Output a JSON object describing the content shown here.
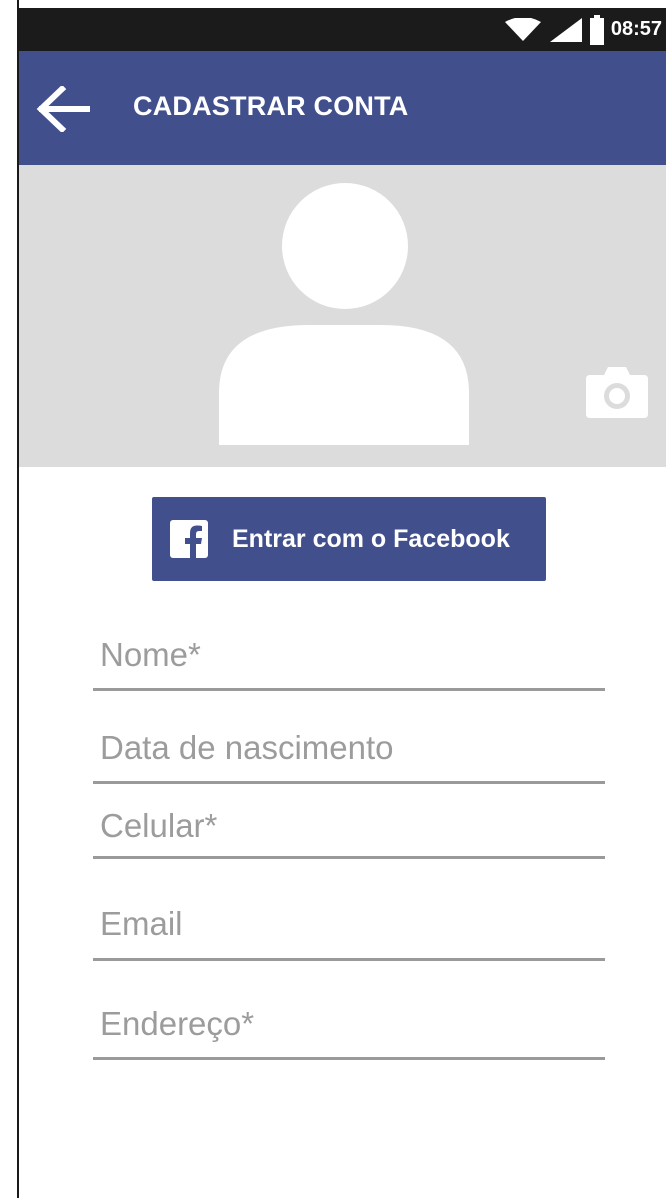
{
  "status_bar": {
    "time": "08:57",
    "icons": [
      "wifi-icon",
      "signal-icon",
      "battery-icon"
    ]
  },
  "app_bar": {
    "title": "CADASTRAR CONTA",
    "back_icon": "arrow-left-icon"
  },
  "profile": {
    "avatar_icon": "person-silhouette-icon",
    "camera_icon": "camera-icon"
  },
  "facebook_button": {
    "label": "Entrar com o Facebook",
    "icon": "facebook-icon"
  },
  "form": {
    "fields": [
      {
        "placeholder": "Nome*",
        "value": ""
      },
      {
        "placeholder": "Data de nascimento",
        "value": ""
      },
      {
        "placeholder": "Celular*",
        "value": ""
      },
      {
        "placeholder": "Email",
        "value": ""
      },
      {
        "placeholder": "Endereço*",
        "value": ""
      }
    ]
  },
  "colors": {
    "primary": "#414f8d",
    "status_bar": "#1b1b1b",
    "photo_bg": "#dcdcdc",
    "placeholder": "#9c9c9c"
  }
}
